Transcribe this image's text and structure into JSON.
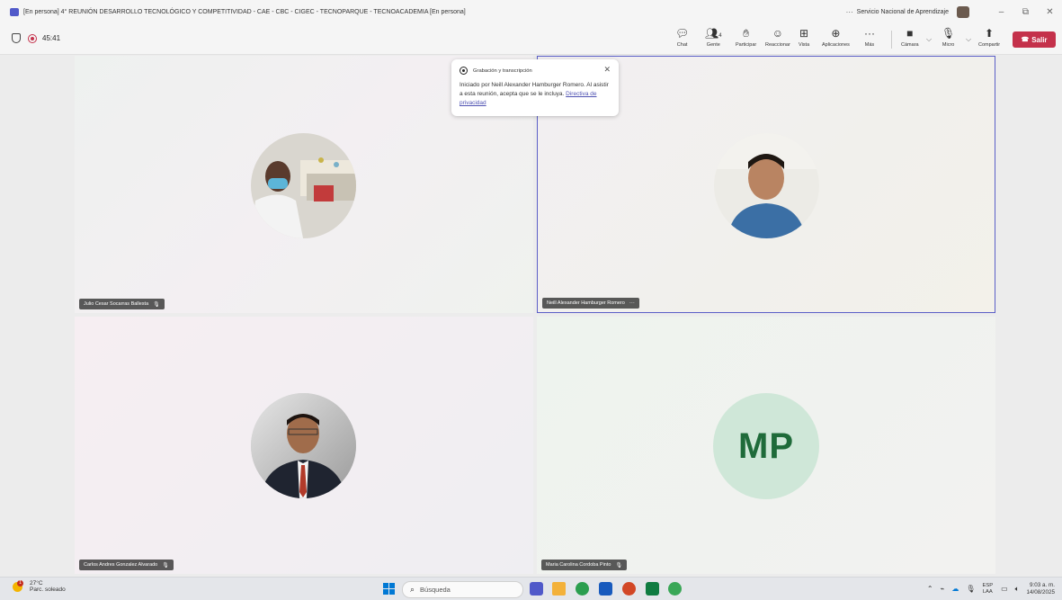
{
  "window": {
    "title": "[En persona] 4° REUNIÓN DESARROLLO TECNOLÓGICO Y COMPETITIVIDAD - CAE - CBC - CIGEC - TECNOPARQUE - TECNOACADEMIA [En persona]",
    "more_dots": "···",
    "org_name": "Servicio Nacional de Aprendizaje"
  },
  "meeting": {
    "timer": "45:41",
    "controls": {
      "chat": "Chat",
      "people": "Gente",
      "people_count": "4",
      "raise": "Participar",
      "react": "Reaccionar",
      "view": "Vista",
      "apps": "Aplicaciones",
      "more": "Más",
      "camera": "Cámara",
      "mic": "Micro",
      "share": "Compartir",
      "leave": "Salir"
    }
  },
  "recording_popup": {
    "title": "Grabación y transcripción",
    "body": "Iniciado por Neill Alexander Hamburger Romero. Al asistir a esta reunión, acepta que se le incluya.",
    "link": "Directiva de privacidad"
  },
  "participants": [
    {
      "name": "Julio Cesar Socarras Ballesta"
    },
    {
      "name": "Neill Alexander Hamburger Romero",
      "extra": "···"
    },
    {
      "name": "Carlos Andres Gonzalez Alvarado"
    },
    {
      "name": "Maria Carolina Cordoba Pinto",
      "initials": "MP"
    }
  ],
  "taskbar": {
    "weather_temp": "27°C",
    "weather_desc": "Parc. soleado",
    "weather_badge": "1",
    "search_placeholder": "Búsqueda",
    "lang_top": "ESP",
    "lang_bottom": "LAA",
    "time": "9:03 a. m.",
    "date": "14/08/2025"
  },
  "colors": {
    "leave": "#c4314b",
    "accent": "#5b5fc7",
    "avatar_mp_bg": "#cfe7d8",
    "avatar_mp_text": "#1f6b3a"
  }
}
